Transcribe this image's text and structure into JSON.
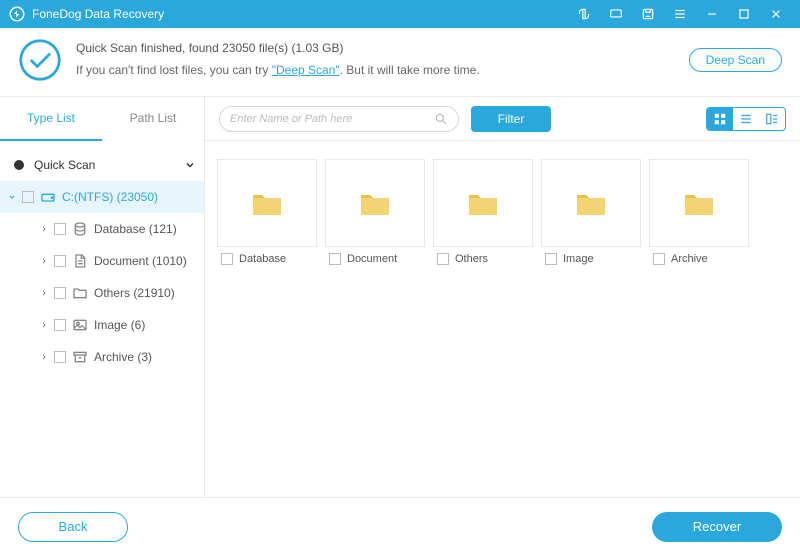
{
  "title": "FoneDog Data Recovery",
  "banner": {
    "line1_prefix": "Quick Scan finished, found ",
    "file_count": "23050",
    "line1_mid": " file(s) (",
    "size": "1.03 GB",
    "line1_suffix": ")",
    "line2_prefix": "If you can't find lost files, you can try ",
    "deep_link": "\"Deep Scan\"",
    "line2_suffix": ". But it will take more time.",
    "deep_button": "Deep Scan"
  },
  "tabs": {
    "type": "Type List",
    "path": "Path List"
  },
  "search": {
    "placeholder": "Enter Name or Path here"
  },
  "filter_label": "Filter",
  "tree": {
    "root": "Quick Scan",
    "drive": "C:(NTFS) (23050)",
    "items": [
      {
        "label": "Database (121)"
      },
      {
        "label": "Document (1010)"
      },
      {
        "label": "Others (21910)"
      },
      {
        "label": "Image (6)"
      },
      {
        "label": "Archive (3)"
      }
    ]
  },
  "folders": [
    {
      "name": "Database"
    },
    {
      "name": "Document"
    },
    {
      "name": "Others"
    },
    {
      "name": "Image"
    },
    {
      "name": "Archive"
    }
  ],
  "footer": {
    "back": "Back",
    "recover": "Recover"
  }
}
